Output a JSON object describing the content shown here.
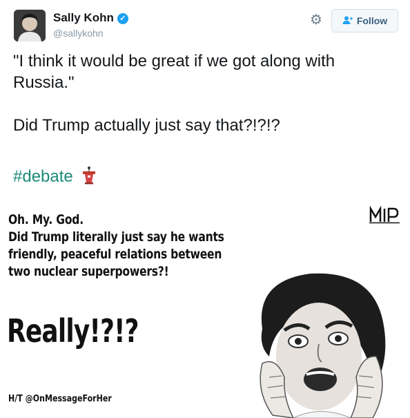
{
  "tweet": {
    "author_name": "Sally Kohn",
    "handle": "@sallykohn",
    "follow_label": "Follow",
    "text": "\"I think it would be great if we got along with Russia.\"\n\nDid Trump actually just say that?!?!?",
    "hashtag": "#debate",
    "icons": {
      "verified": "verified-badge-icon",
      "settings": "gear-icon",
      "follow": "add-person-icon",
      "emoji": "podium-icon"
    },
    "colors": {
      "accent": "#1da1f2",
      "hashtag": "#1b8a7a",
      "text": "#14171a",
      "muted": "#8899a6"
    }
  },
  "meme": {
    "lines": [
      "Oh. My. God.",
      "Did Trump literally just say he wants",
      "friendly, peaceful relations between",
      "two nuclear superpowers?!"
    ],
    "exclamation": "Really!?!?",
    "credit": "H/T @OnMessageForHer",
    "logo_text": "MIP"
  }
}
